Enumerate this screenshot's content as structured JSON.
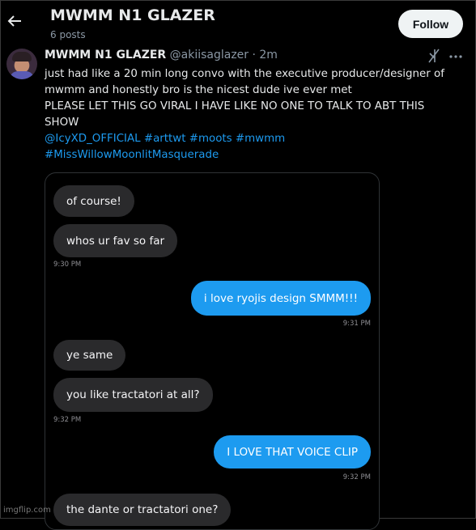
{
  "header": {
    "title": "MWMM N1 GLAZER",
    "post_count": "6 posts",
    "follow_label": "Follow"
  },
  "post": {
    "display_name": "MWMM N1 GLAZER",
    "handle_time": "@akiisaglazer · 2m",
    "lines": [
      "just had like a 20 min long convo with the executive producer/designer of",
      "mwmm and honestly bro is the nicest dude ive ever met",
      "PLEASE LET THIS GO VIRAL I HAVE LIKE NO ONE TO TALK TO ABT THIS",
      "SHOW"
    ],
    "tags_line1": "@IcyXD_OFFICIAL  #arttwt #moots #mwmm",
    "tags_line2": "#MissWillowMoonlitMasquerade"
  },
  "chat": {
    "messages": [
      {
        "text": "of course!",
        "side": "received"
      },
      {
        "text": "whos ur fav so far",
        "side": "received"
      },
      {
        "time": "9:30 PM"
      },
      {
        "text": "i love ryojis design SMMM!!!",
        "side": "sent"
      },
      {
        "time": "9:31 PM"
      },
      {
        "text": "ye same",
        "side": "received"
      },
      {
        "text": "you like tractatori at all?",
        "side": "received"
      },
      {
        "time": "9:32 PM"
      },
      {
        "text": "I LOVE THAT VOICE CLIP",
        "side": "sent"
      },
      {
        "time": "9:32 PM"
      },
      {
        "text": "the dante or tractatori one?",
        "side": "received"
      }
    ]
  },
  "watermark": "imgflip.com",
  "colors": {
    "background": "#000000",
    "accent_link": "#1d9bf0",
    "sent_bubble": "#1d9bf0",
    "received_bubble": "#2a2a2c",
    "follow_button": "#eff3f4"
  },
  "icons": [
    "back-arrow-icon",
    "grok-icon",
    "more-options-icon"
  ]
}
